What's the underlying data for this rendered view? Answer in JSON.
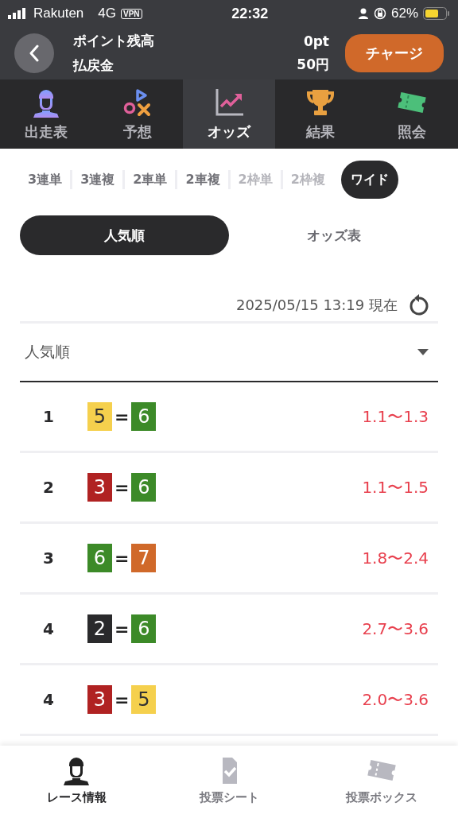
{
  "status_bar": {
    "carrier": "Rakuten",
    "network": "4G",
    "vpn": "VPN",
    "time": "22:32",
    "battery": "62%"
  },
  "header": {
    "labels": [
      "ポイント残高",
      "払戻金"
    ],
    "values": [
      "0pt",
      "50円"
    ],
    "charge_button": "チャージ"
  },
  "nav_tabs": [
    {
      "label": "出走表",
      "kind": "rider",
      "selected": false
    },
    {
      "label": "予想",
      "kind": "forecast",
      "selected": false
    },
    {
      "label": "オッズ",
      "kind": "odds",
      "selected": true
    },
    {
      "label": "結果",
      "kind": "trophy",
      "selected": false
    },
    {
      "label": "照会",
      "kind": "ticket",
      "selected": false
    }
  ],
  "bet_types": [
    {
      "label": "3連単",
      "selected": false,
      "disabled": false
    },
    {
      "label": "3連複",
      "selected": false,
      "disabled": false
    },
    {
      "label": "2車単",
      "selected": false,
      "disabled": false
    },
    {
      "label": "2車複",
      "selected": false,
      "disabled": false
    },
    {
      "label": "2枠単",
      "selected": false,
      "disabled": true
    },
    {
      "label": "2枠複",
      "selected": false,
      "disabled": true
    },
    {
      "label": "ワイド",
      "selected": true,
      "disabled": false
    }
  ],
  "view_toggle": [
    {
      "label": "人気順",
      "selected": true
    },
    {
      "label": "オッズ表",
      "selected": false
    }
  ],
  "updated": "2025/05/15 13:19 現在",
  "sort_dropdown": {
    "value": "人気順"
  },
  "odds_rows": [
    {
      "rank": "1",
      "first": {
        "number": "5",
        "color": "#f5d04d"
      },
      "separator": "=",
      "second": {
        "number": "6",
        "color": "#3c8a28"
      },
      "odds": "1.1〜1.3"
    },
    {
      "rank": "2",
      "first": {
        "number": "3",
        "color": "#b02222"
      },
      "separator": "=",
      "second": {
        "number": "6",
        "color": "#3c8a28"
      },
      "odds": "1.1〜1.5"
    },
    {
      "rank": "3",
      "first": {
        "number": "6",
        "color": "#3c8a28"
      },
      "separator": "=",
      "second": {
        "number": "7",
        "color": "#d0692a"
      },
      "odds": "1.8〜2.4"
    },
    {
      "rank": "4",
      "first": {
        "number": "2",
        "color": "#2a2a2c"
      },
      "separator": "=",
      "second": {
        "number": "6",
        "color": "#3c8a28"
      },
      "odds": "2.7〜3.6"
    },
    {
      "rank": "4",
      "first": {
        "number": "3",
        "color": "#b02222"
      },
      "separator": "=",
      "second": {
        "number": "5",
        "color": "#f5d04d"
      },
      "odds": "2.0〜3.6"
    }
  ],
  "bottom_nav": [
    {
      "label": "レース情報",
      "kind": "rider",
      "selected": true
    },
    {
      "label": "投票シート",
      "kind": "sheet",
      "selected": false
    },
    {
      "label": "投票ボックス",
      "kind": "ticket",
      "selected": false
    }
  ]
}
